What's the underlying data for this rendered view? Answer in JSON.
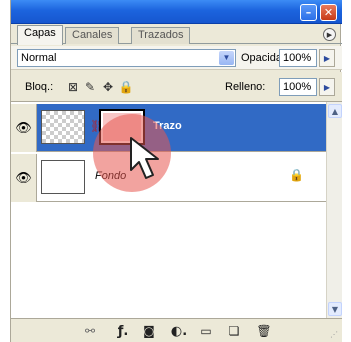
{
  "colors": {
    "titlebar": "#1c64de",
    "selected_row": "#316ac5",
    "highlight": "#e85850",
    "mask_fill": "#f7c6c6",
    "panel_bg": "#ece9d8"
  },
  "window": {
    "minimize_icon": "minimize-icon",
    "minimize_glyph": "–",
    "close_icon": "close-icon",
    "close_glyph": "✕"
  },
  "tabs": [
    {
      "label": "Capas",
      "active": true
    },
    {
      "label": "Canales",
      "active": false
    },
    {
      "label": "Trazados",
      "active": false
    }
  ],
  "panel_menu_glyph": "▶",
  "mode": {
    "blend_mode": "Normal",
    "dropdown_glyph": "▼",
    "opacity_label": "Opacidad:",
    "opacity_value": "100%",
    "stepper_glyph": "▶"
  },
  "locks": {
    "label": "Bloq.:",
    "transparency_glyph": "⊠",
    "image_glyph": "✎",
    "position_glyph": "✥",
    "all_glyph": "🔒",
    "fill_label": "Relleno:",
    "fill_value": "100%"
  },
  "layers": [
    {
      "name": "Trazo",
      "selected": true,
      "visible": true,
      "has_mask": true,
      "link_glyph": "⛓"
    },
    {
      "name": "Fondo",
      "selected": false,
      "visible": true,
      "locked": true,
      "lock_glyph": "🔒"
    }
  ],
  "eye_glyph": "👁",
  "scroll": {
    "up_glyph": "▲",
    "down_glyph": "▼"
  },
  "bottom_toolbar": {
    "link_glyph": "⚯",
    "fx_glyph": "ƒ.",
    "mask_glyph": "◙",
    "adjust_glyph": "◐.",
    "folder_glyph": "▭",
    "new_glyph": "❏",
    "trash_glyph": "🗑",
    "grip_glyph": "⋰"
  }
}
